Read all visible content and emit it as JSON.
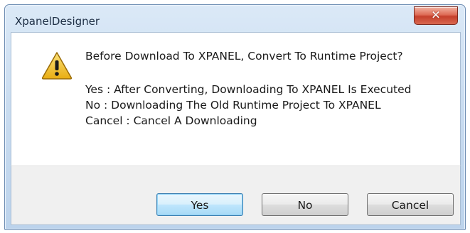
{
  "window": {
    "title": "XpanelDesigner",
    "close_icon": "close-icon"
  },
  "message": {
    "icon": "warning-icon",
    "main": "Before Download To XPANEL, Convert To Runtime Project?",
    "details": [
      "Yes : After Converting, Downloading To XPANEL Is Executed",
      "No : Downloading The Old Runtime Project To XPANEL",
      "Cancel : Cancel A Downloading"
    ]
  },
  "buttons": {
    "yes": "Yes",
    "no": "No",
    "cancel": "Cancel"
  },
  "colors": {
    "warning_fill": "#f2c230",
    "close_button": "#c5402c",
    "default_button_border": "#3c7fb1"
  }
}
